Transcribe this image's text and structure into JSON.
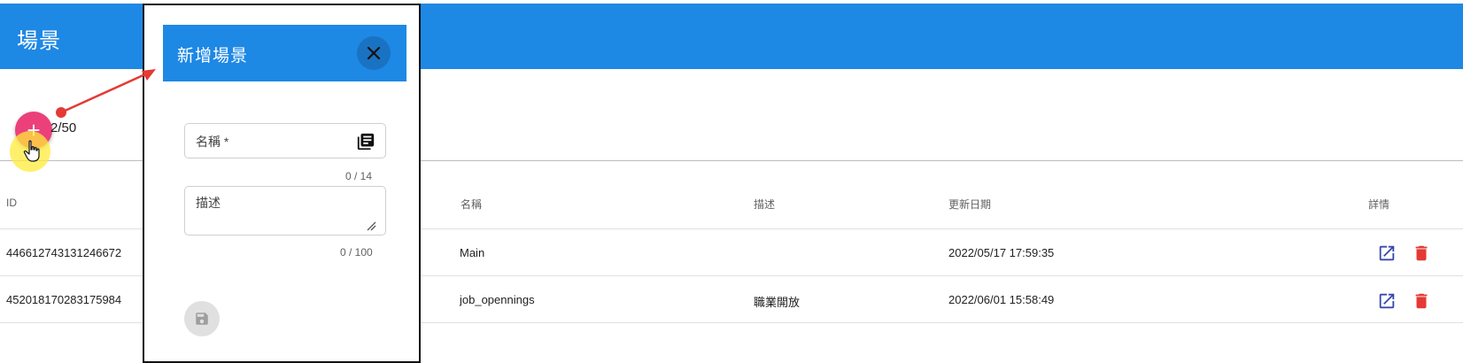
{
  "header": {
    "title": "場景"
  },
  "toolbar": {
    "add_icon": "plus-icon",
    "count": "2/50"
  },
  "table": {
    "columns": {
      "id": "ID",
      "name": "名稱",
      "description": "描述",
      "updated": "更新日期",
      "details": "詳情"
    },
    "rows": [
      {
        "id": "446612743131246672",
        "name": "Main",
        "description": "",
        "updated": "2022/05/17 17:59:35"
      },
      {
        "id": "452018170283175984",
        "name": "job_opennings",
        "description": "職業開放",
        "updated": "2022/06/01 15:58:49"
      }
    ]
  },
  "dialog": {
    "title": "新增場景",
    "name_label": "名稱 *",
    "name_value": "",
    "name_counter": "0 / 14",
    "desc_label": "描述",
    "desc_value": "",
    "desc_counter": "0 / 100"
  },
  "colors": {
    "primary": "#1e88e5",
    "fab": "#ec407a",
    "edit_icon": "#3949ab",
    "delete_icon": "#e53935",
    "annotation": "#e53935"
  }
}
